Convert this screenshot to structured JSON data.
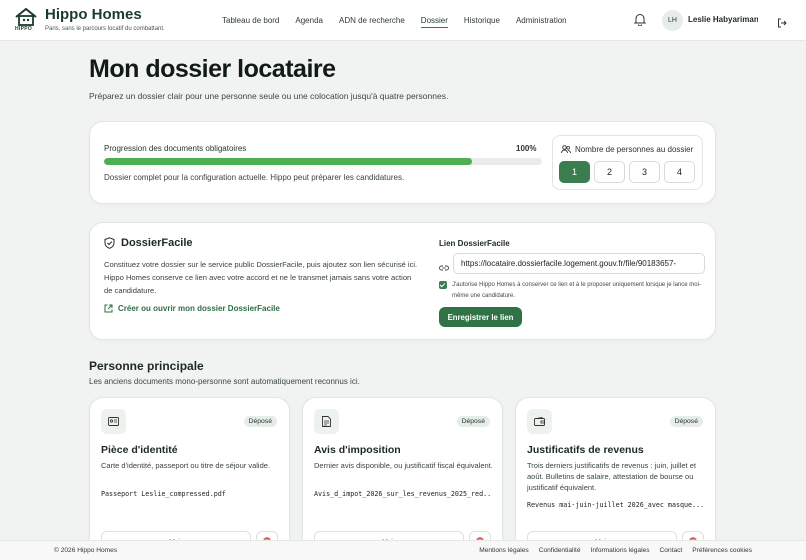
{
  "header": {
    "brand_name": "Hippo Homes",
    "tagline": "Paris, sans le parcours locatif du combattant.",
    "logo_caption": "HIPPO",
    "nav": [
      {
        "label": "Tableau de bord"
      },
      {
        "label": "Agenda"
      },
      {
        "label": "ADN de recherche"
      },
      {
        "label": "Dossier",
        "active": true
      },
      {
        "label": "Historique"
      },
      {
        "label": "Administration"
      }
    ],
    "avatar_initials": "LH",
    "user_name": "Leslie Habyarimana"
  },
  "page": {
    "title": "Mon dossier locataire",
    "subtitle": "Préparez un dossier clair pour une personne seule ou une colocation jusqu'à quatre personnes."
  },
  "progress": {
    "label": "Progression des documents obligatoires",
    "percent_text": "100%",
    "fill_fraction": 0.84,
    "note": "Dossier complet pour la configuration actuelle. Hippo peut préparer les candidatures."
  },
  "people": {
    "title": "Nombre de personnes au dossier",
    "options": [
      "1",
      "2",
      "3",
      "4"
    ],
    "selected": "1"
  },
  "dossierfacile": {
    "title": "DossierFacile",
    "description": "Constituez votre dossier sur le service public DossierFacile, puis ajoutez son lien sécurisé ici. Hippo Homes conserve ce lien avec votre accord et ne le transmet jamais sans votre action de candidature.",
    "create_link": "Créer ou ouvrir mon dossier DossierFacile",
    "link_label": "Lien DossierFacile",
    "url_value": "https://locataire.dossierfacile.logement.gouv.fr/file/90183657-",
    "consent_text": "J'autorise Hippo Homes à conserver ce lien et à le proposer uniquement lorsque je lance moi-même une candidature.",
    "save_label": "Enregistrer le lien"
  },
  "section": {
    "title": "Personne principale",
    "subtitle": "Les anciens documents mono-personne sont automatiquement reconnus ici."
  },
  "documents": [
    {
      "title": "Pièce d'identité",
      "badge": "Déposé",
      "description": "Carte d'identité, passeport ou titre de séjour valide.",
      "file": "Passeport Leslie_compressed.pdf",
      "view_label": "Voir",
      "icon": "id-card-icon"
    },
    {
      "title": "Avis d'imposition",
      "badge": "Déposé",
      "description": "Dernier avis disponible, ou justificatif fiscal équivalent.",
      "file": "Avis_d_impot_2026_sur_les_revenus_2025_red...",
      "view_label": "Voir",
      "icon": "document-icon"
    },
    {
      "title": "Justificatifs de revenus",
      "badge": "Déposé",
      "description": "Trois derniers justificatifs de revenus : juin, juillet et août. Bulletins de salaire, attestation de bourse ou justificatif équivalent.",
      "file": "Revenus mai-juin-juillet 2026_avec masque...",
      "view_label": "Voir",
      "icon": "wallet-icon"
    }
  ],
  "footer": {
    "copyright": "© 2026 Hippo Homes",
    "links": [
      "Mentions légales",
      "Confidentialité",
      "Informations légales",
      "Contact",
      "Préférences cookies"
    ]
  }
}
